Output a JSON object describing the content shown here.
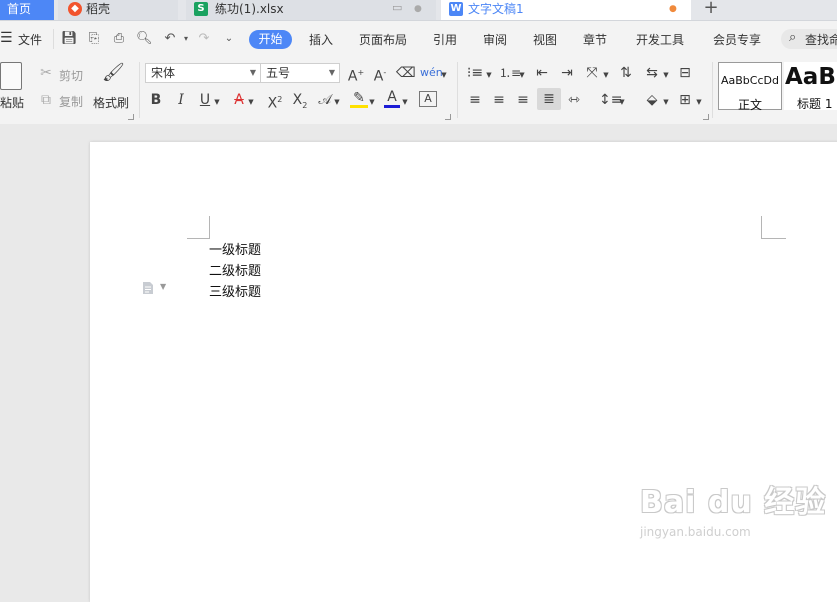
{
  "tabs": {
    "home": "首页",
    "daoke": "稻壳",
    "xlsx": "练功(1).xlsx",
    "doc": "文字文稿1",
    "add": "+"
  },
  "menu": {
    "file": "文件",
    "items": [
      "开始",
      "插入",
      "页面布局",
      "引用",
      "审阅",
      "视图",
      "章节",
      "开发工具",
      "会员专享"
    ],
    "search": "查找命"
  },
  "ribbon": {
    "paste": "粘贴",
    "cut": "剪切",
    "copy": "复制",
    "format_painter": "格式刷",
    "font_name": "宋体",
    "font_size": "五号",
    "style_normal_preview": "AaBbCcDd",
    "style_normal_label": "正文",
    "style_h1_preview": "AaBl",
    "style_h1_label": "标题 1"
  },
  "document": {
    "lines": [
      "一级标题",
      "二级标题",
      "三级标题"
    ]
  },
  "watermark": {
    "brand": "Bai du 经验",
    "url": "jingyan.baidu.com"
  },
  "colors": {
    "accent": "#4d87f6",
    "highlight": "#ffe100",
    "font_color": "#1c1cd6",
    "font_red": "#d33"
  }
}
